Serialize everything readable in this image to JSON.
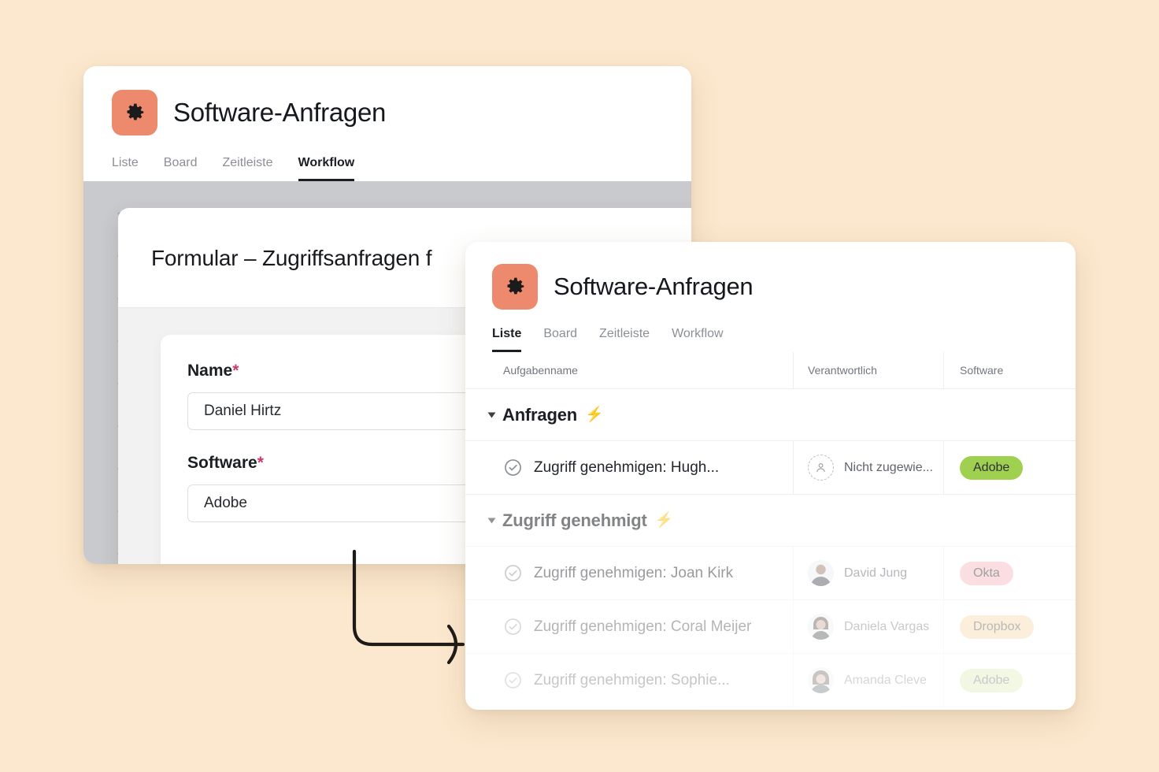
{
  "background_color": "#fce8ce",
  "accent_color": "#ed8a6d",
  "workflow_window": {
    "logo_icon": "gear-icon",
    "title": "Software-Anfragen",
    "tabs": [
      {
        "label": "Liste",
        "active": false
      },
      {
        "label": "Board",
        "active": false
      },
      {
        "label": "Zeitleiste",
        "active": false
      },
      {
        "label": "Workflow",
        "active": true
      }
    ],
    "form_panel": {
      "title": "Formular – Zugriffsanfragen f",
      "fields": [
        {
          "label": "Name",
          "required_marker": "*",
          "value": "Daniel Hirtz"
        },
        {
          "label": "Software",
          "required_marker": "*",
          "value": "Adobe"
        }
      ]
    }
  },
  "list_window": {
    "logo_icon": "gear-icon",
    "title": "Software-Anfragen",
    "tabs": [
      {
        "label": "Liste",
        "active": true
      },
      {
        "label": "Board",
        "active": false
      },
      {
        "label": "Zeitleiste",
        "active": false
      },
      {
        "label": "Workflow",
        "active": false
      }
    ],
    "columns": [
      "Aufgabenname",
      "Verantwortlich",
      "Software"
    ],
    "groups": [
      {
        "name": "Anfragen",
        "icon": "lightning-bolt-icon",
        "rows": [
          {
            "status_icon": "check-circle-icon",
            "task": "Zugriff genehmigen: Hugh...",
            "owner": "Nicht zugewie...",
            "owner_avatar": "unassigned-avatar-icon",
            "software": "Adobe",
            "software_color": "#a0d04f",
            "faded": false
          }
        ]
      },
      {
        "name": "Zugriff genehmigt",
        "icon": "lightning-bolt-icon",
        "rows": [
          {
            "status_icon": "check-circle-icon",
            "task": "Zugriff genehmigen: Joan Kirk",
            "owner": "David Jung",
            "owner_avatar": "photo-avatar-male",
            "software": "Okta",
            "software_color": "#f7b9bf",
            "faded": true
          },
          {
            "status_icon": "check-circle-icon",
            "task": "Zugriff genehmigen: Coral Meijer",
            "owner": "Daniela Vargas",
            "owner_avatar": "photo-avatar-female",
            "software": "Dropbox",
            "software_color": "#f6ce95",
            "faded": true
          },
          {
            "status_icon": "check-circle-icon",
            "task": "Zugriff genehmigen: Sophie...",
            "owner": "Amanda Cleve",
            "owner_avatar": "photo-avatar-female-2",
            "software": "Adobe",
            "software_color": "#cfe49a",
            "faded": true
          }
        ]
      }
    ]
  },
  "connector": {
    "icon": "arrow-connector",
    "description": "elbow arrow pointing from workflow window to list window"
  }
}
